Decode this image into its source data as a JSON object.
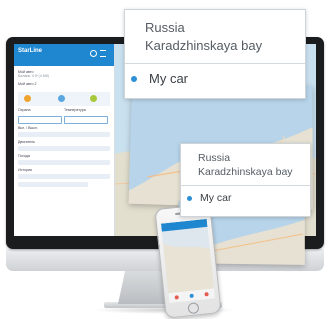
{
  "desktop_app": {
    "logo": "StarLine",
    "rows": [
      "Мой авто",
      "Баланс: 0 ₽ (4 Мб)",
      "Мой авто 2",
      "Охрана",
      "Температура",
      "Вкл. / Выкл.",
      "Двигатель",
      "Погода",
      "История"
    ]
  },
  "big_card": {
    "country": "Russia",
    "place": "Karadzhinskaya bay",
    "car_label": "My car"
  },
  "small_card": {
    "country": "Russia",
    "place": "Karadzhinskaya bay",
    "car_label": "My car"
  },
  "colors": {
    "accent": "#2d8fd5",
    "header_blue": "#1f87cf",
    "sea": "#b9d6ea",
    "land": "#e8e4d6"
  }
}
